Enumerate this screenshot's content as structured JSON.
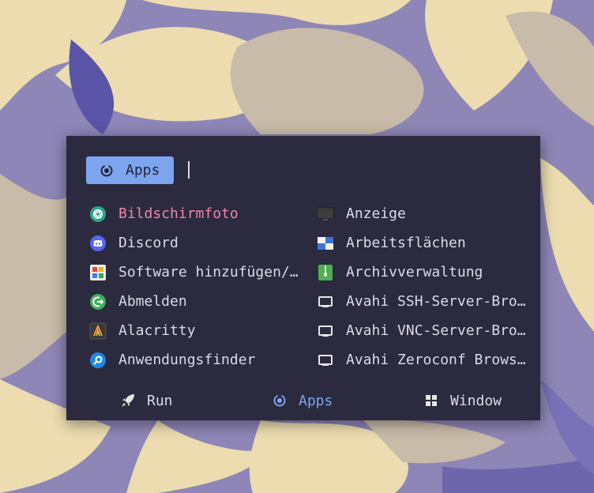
{
  "prompt": {
    "icon": "apps-icon",
    "label": "Apps"
  },
  "entries": [
    {
      "label": "Bildschirmfoto",
      "icon": "camera-shutter-icon",
      "selected": true
    },
    {
      "label": "Anzeige",
      "icon": "monitor-icon"
    },
    {
      "label": "Discord",
      "icon": "discord-icon"
    },
    {
      "label": "Arbeitsflächen",
      "icon": "workspaces-icon"
    },
    {
      "label": "Software hinzufügen/…",
      "icon": "software-icon"
    },
    {
      "label": "Archivverwaltung",
      "icon": "archive-icon"
    },
    {
      "label": "Abmelden",
      "icon": "logout-icon"
    },
    {
      "label": "Avahi SSH-Server-Bro…",
      "icon": "network-icon"
    },
    {
      "label": "Alacritty",
      "icon": "terminal-icon"
    },
    {
      "label": "Avahi VNC-Server-Bro…",
      "icon": "network-icon"
    },
    {
      "label": "Anwendungsfinder",
      "icon": "search-icon"
    },
    {
      "label": "Avahi Zeroconf Brows…",
      "icon": "network-icon"
    }
  ],
  "modes": [
    {
      "label": "Run",
      "icon": "rocket-icon"
    },
    {
      "label": "Apps",
      "icon": "apps-icon",
      "active": true
    },
    {
      "label": "Window",
      "icon": "window-grid-icon"
    }
  ],
  "colors": {
    "accent": "#7da4ef",
    "selected_text": "#ee87a8",
    "panel_bg": "#2b2a3e",
    "text": "#d9dbe8"
  }
}
